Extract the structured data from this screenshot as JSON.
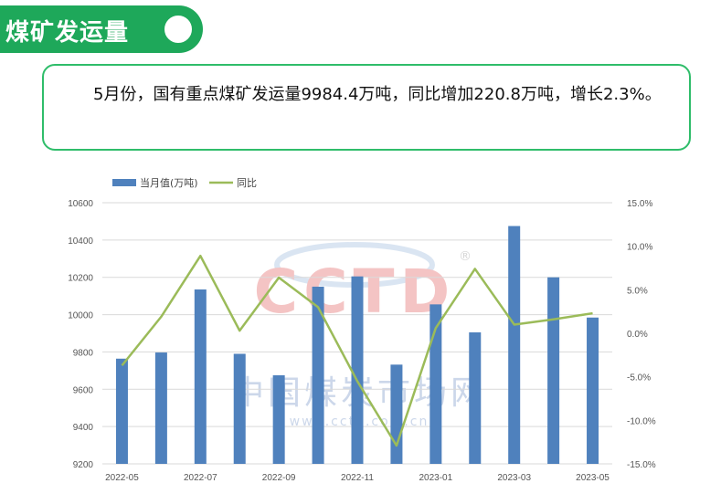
{
  "header": {
    "title": "煤矿发运量"
  },
  "summary": {
    "text": "5月份，国有重点煤矿发运量9984.4万吨，同比增加220.8万吨，增长2.3%。"
  },
  "watermark": {
    "logo": "CCTD",
    "registered": "®",
    "name": "中国煤炭市场网",
    "url": "www.cctd.com.cn"
  },
  "colors": {
    "bar": "#4f81bd",
    "line": "#9bbb59",
    "accent": "#1ea85a"
  },
  "chart_data": {
    "type": "bar",
    "categories": [
      "2022-05",
      "2022-06",
      "2022-07",
      "2022-08",
      "2022-09",
      "2022-10",
      "2022-11",
      "2022-12",
      "2023-01",
      "2023-02",
      "2023-03",
      "2023-04",
      "2023-05"
    ],
    "x_tick_labels": [
      "2022-05",
      "2022-07",
      "2022-09",
      "2022-11",
      "2023-01",
      "2023-03",
      "2023-05"
    ],
    "series": [
      {
        "name": "当月值(万吨)",
        "type": "bar",
        "axis": "left",
        "values": [
          9764,
          9797,
          10135,
          9790,
          9675,
          10150,
          10205,
          9732,
          10055,
          9905,
          10475,
          10200,
          9984.4
        ]
      },
      {
        "name": "同比",
        "type": "line",
        "axis": "right",
        "values": [
          -3.7,
          1.9,
          8.9,
          0.3,
          6.4,
          3.0,
          -5.5,
          -12.9,
          0.6,
          7.4,
          1.0,
          1.6,
          2.3
        ]
      }
    ],
    "y_left": {
      "min": 9200,
      "max": 10600,
      "ticks": [
        "9200",
        "9400",
        "9600",
        "9800",
        "10000",
        "10200",
        "10400",
        "10600"
      ]
    },
    "y_right": {
      "min": -15,
      "max": 15,
      "ticks": [
        "-15.0%",
        "-10.0%",
        "-5.0%",
        "0.0%",
        "5.0%",
        "10.0%",
        "15.0%"
      ]
    },
    "legend_position": "top-left",
    "grid": true
  }
}
